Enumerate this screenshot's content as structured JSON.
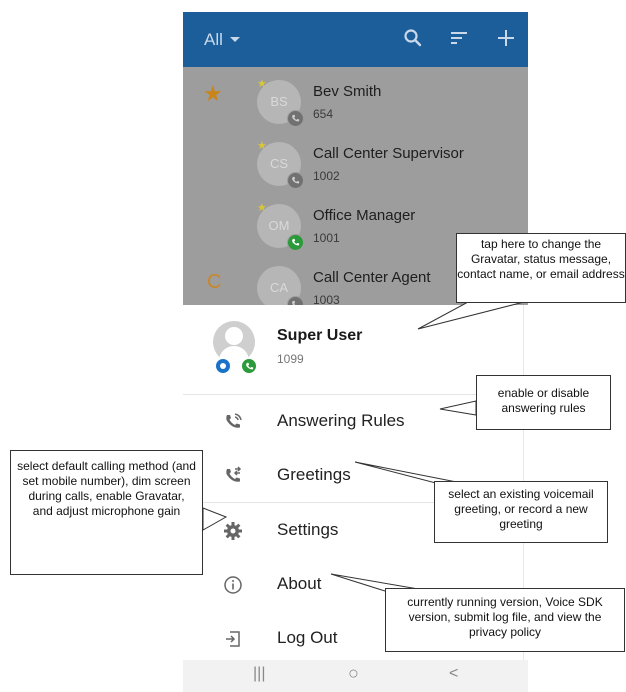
{
  "app_bar": {
    "filter_label": "All",
    "icons": [
      "search-icon",
      "sort-icon",
      "add-icon"
    ],
    "color": "#1c5e9a"
  },
  "contacts": [
    {
      "section": "star",
      "initials": "BS",
      "name": "Bev Smith",
      "extension": "654",
      "favorite": true,
      "status": "gray"
    },
    {
      "section": "",
      "initials": "CS",
      "name": "Call Center Supervisor",
      "extension": "1002",
      "favorite": true,
      "status": "gray"
    },
    {
      "section": "",
      "initials": "OM",
      "name": "Office Manager",
      "extension": "1001",
      "favorite": true,
      "status": "green"
    },
    {
      "section": "C",
      "initials": "CA",
      "name": "Call Center Agent",
      "extension": "1003",
      "favorite": false,
      "status": "gray"
    }
  ],
  "drawer": {
    "user_name": "Super User",
    "user_extension": "1099",
    "menu": [
      {
        "label": "Answering Rules",
        "icon": "answering-rules-icon"
      },
      {
        "label": "Greetings",
        "icon": "greetings-icon"
      },
      {
        "label": "Settings",
        "icon": "gear-icon"
      },
      {
        "label": "About",
        "icon": "info-icon"
      },
      {
        "label": "Log Out",
        "icon": "logout-icon"
      }
    ]
  },
  "navbar": {
    "recents": "|||",
    "home": "○",
    "back": "<"
  },
  "callouts": {
    "profile": "tap here to change the Gravatar, status message, contact name, or email address",
    "answering_rules": "enable or disable answering rules",
    "greetings": "select an existing voicemail greeting, or record a new greeting",
    "settings": "select default calling method (and set mobile number), dim screen during calls, enable Gravatar, and adjust microphone gain",
    "about": "currently running version, Voice SDK version, submit log file, and view the privacy policy"
  },
  "colors": {
    "star": "#c9851a",
    "status_green": "#2a9a3a",
    "status_blue": "#1a73c8"
  }
}
